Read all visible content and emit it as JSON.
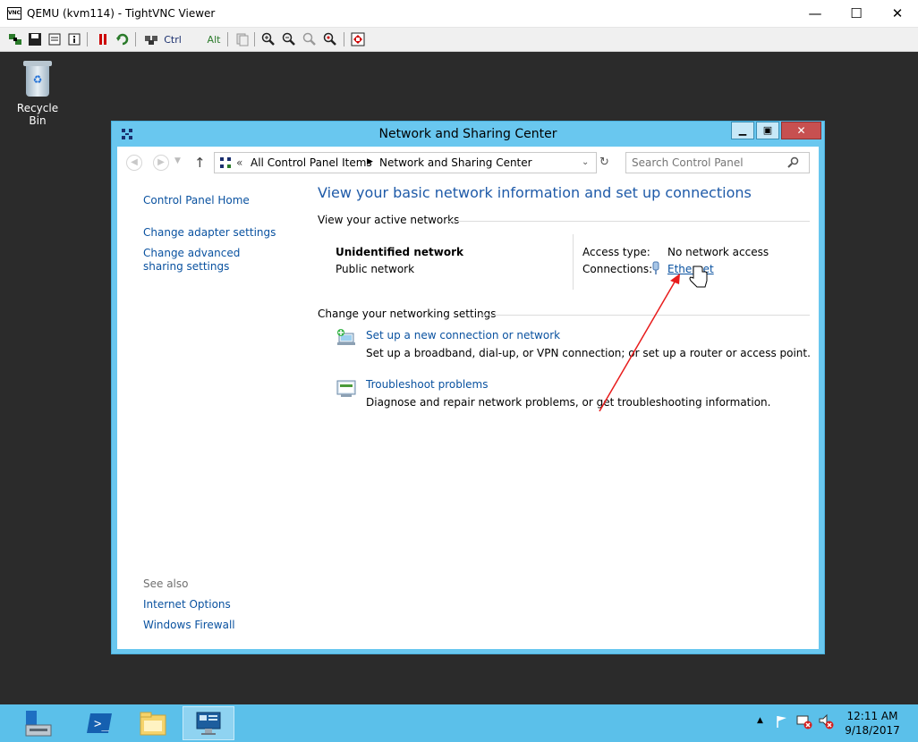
{
  "viewer": {
    "title": "QEMU (kvm114) - TightVNC Viewer",
    "logo_text": "VNC",
    "controls": {
      "minimize": "—",
      "maximize": "☐",
      "close": "✕"
    },
    "toolbar": {
      "ctrl_label": "Ctrl",
      "alt_label": "Alt"
    }
  },
  "desktop": {
    "recycle_bin_label": "Recycle Bin"
  },
  "window": {
    "title": "Network and Sharing Center",
    "breadcrumb": {
      "chevron": "«",
      "items": [
        "All Control Panel Items",
        "Network and Sharing Center"
      ]
    },
    "search_placeholder": "Search Control Panel",
    "sidebar": {
      "home": "Control Panel Home",
      "items": [
        "Change adapter settings",
        "Change advanced sharing settings"
      ],
      "see_also_label": "See also",
      "see_also": [
        "Internet Options",
        "Windows Firewall"
      ]
    },
    "main": {
      "heading": "View your basic network information and set up connections",
      "active_networks_label": "View your active networks",
      "network_name": "Unidentified network",
      "network_type": "Public network",
      "access_type_label": "Access type:",
      "access_type_value": "No network access",
      "connections_label": "Connections:",
      "connection_link": "Ethernet",
      "change_settings_label": "Change your networking settings",
      "tasks": [
        {
          "title": "Set up a new connection or network",
          "desc": "Set up a broadband, dial-up, or VPN connection; or set up a router or access point."
        },
        {
          "title": "Troubleshoot problems",
          "desc": "Diagnose and repair network problems, or get troubleshooting information."
        }
      ]
    }
  },
  "taskbar": {
    "time": "12:11 AM",
    "date": "9/18/2017"
  },
  "colors": {
    "accent": "#69c7ef",
    "taskbar": "#5bc0ea",
    "link": "#0a52a0",
    "annotation_arrow": "#e81c1c"
  }
}
